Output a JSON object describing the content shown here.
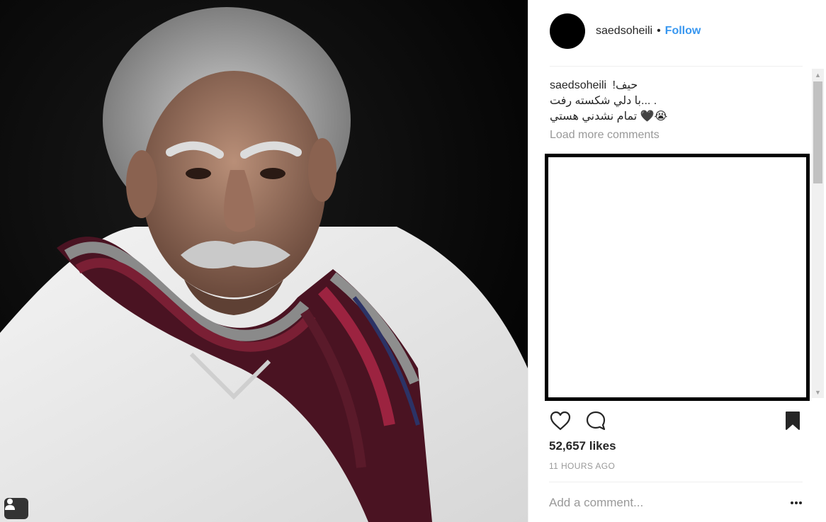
{
  "post": {
    "username": "saedsoheili",
    "separator": "•",
    "follow_label": "Follow"
  },
  "caption": {
    "username": "saedsoheili",
    "line1": "حيف!",
    "line2": ". ...با دلي شكسته رفت",
    "line3": "😭🖤 تمام نشدني هستي"
  },
  "comments": {
    "load_more": "Load more comments"
  },
  "stats": {
    "likes": "52,657 likes",
    "timestamp": "11 HOURS AGO"
  },
  "comment_box": {
    "placeholder": "Add a comment..."
  },
  "icons": {
    "like": "heart-icon",
    "comment": "speech-bubble-icon",
    "save": "bookmark-icon",
    "more": "ellipsis-icon",
    "tagged_people": "user-tag-icon"
  },
  "colors": {
    "link": "#3897f0",
    "muted": "#999999",
    "text": "#262626"
  }
}
